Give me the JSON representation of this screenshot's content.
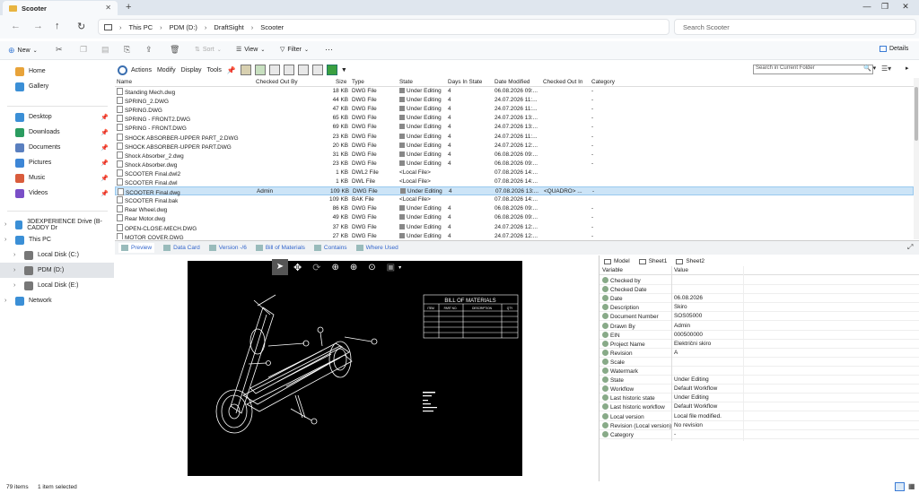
{
  "window": {
    "tab_title": "Scooter"
  },
  "address": {
    "crumbs": [
      "This PC",
      "PDM (D:)",
      "DraftSight",
      "Scooter"
    ],
    "search_placeholder": "Search Scooter"
  },
  "toolbar": {
    "new": "New",
    "sort": "Sort",
    "view": "View",
    "filter": "Filter",
    "more": "···",
    "details": "Details"
  },
  "nav": {
    "quick": [
      {
        "label": "Home",
        "color": "#e8a33a"
      },
      {
        "label": "Gallery",
        "color": "#3b8fd6"
      }
    ],
    "pinned": [
      {
        "label": "Desktop",
        "color": "#3b8fd6"
      },
      {
        "label": "Downloads",
        "color": "#2b9c60"
      },
      {
        "label": "Documents",
        "color": "#5a7fbf"
      },
      {
        "label": "Pictures",
        "color": "#3d86d6"
      },
      {
        "label": "Music",
        "color": "#d95c3c"
      },
      {
        "label": "Videos",
        "color": "#7a4fc7"
      }
    ],
    "tree": [
      {
        "label": "3DEXPERIENCE Drive (B-CADDY Dr",
        "level": 0,
        "color": "#3b8fd6"
      },
      {
        "label": "This PC",
        "level": 0,
        "color": "#3b8fd6"
      },
      {
        "label": "Local Disk (C:)",
        "level": 1,
        "color": "#777"
      },
      {
        "label": "PDM (D:)",
        "level": 1,
        "color": "#777",
        "selected": true
      },
      {
        "label": "Local Disk (E:)",
        "level": 1,
        "color": "#777"
      },
      {
        "label": "Network",
        "level": 0,
        "color": "#3b8fd6"
      }
    ]
  },
  "pdm": {
    "menus": [
      "Actions",
      "Modify",
      "Display",
      "Tools"
    ],
    "search_placeholder": "Search in Current Folder"
  },
  "files": {
    "columns": [
      "Name",
      "Checked Out By",
      "Size",
      "Type",
      "State",
      "Days In State",
      "Date Modified",
      "Checked Out In",
      "Category"
    ],
    "rows": [
      {
        "name": "Standing Mech.dwg",
        "by": "",
        "size": "18 KB",
        "type": "DWG File",
        "state": "Under Editing",
        "days": "4",
        "date": "06.08.2026 09:...",
        "in": "",
        "cat": "-"
      },
      {
        "name": "SPRING_2.DWG",
        "by": "",
        "size": "44 KB",
        "type": "DWG File",
        "state": "Under Editing",
        "days": "4",
        "date": "24.07.2026 11:...",
        "in": "",
        "cat": "-"
      },
      {
        "name": "SPRING.DWG",
        "by": "",
        "size": "47 KB",
        "type": "DWG File",
        "state": "Under Editing",
        "days": "4",
        "date": "24.07.2026 11:...",
        "in": "",
        "cat": "-"
      },
      {
        "name": "SPRING - FRONT2.DWG",
        "by": "",
        "size": "65 KB",
        "type": "DWG File",
        "state": "Under Editing",
        "days": "4",
        "date": "24.07.2026 13:...",
        "in": "",
        "cat": "-"
      },
      {
        "name": "SPRING - FRONT.DWG",
        "by": "",
        "size": "69 KB",
        "type": "DWG File",
        "state": "Under Editing",
        "days": "4",
        "date": "24.07.2026 13:...",
        "in": "",
        "cat": "-"
      },
      {
        "name": "SHOCK ABSORBER-UPPER PART_2.DWG",
        "by": "",
        "size": "23 KB",
        "type": "DWG File",
        "state": "Under Editing",
        "days": "4",
        "date": "24.07.2026 11:...",
        "in": "",
        "cat": "-"
      },
      {
        "name": "SHOCK ABSORBER-UPPER PART.DWG",
        "by": "",
        "size": "20 KB",
        "type": "DWG File",
        "state": "Under Editing",
        "days": "4",
        "date": "24.07.2026 12:...",
        "in": "",
        "cat": "-"
      },
      {
        "name": "Shock Absorber_2.dwg",
        "by": "",
        "size": "31 KB",
        "type": "DWG File",
        "state": "Under Editing",
        "days": "4",
        "date": "06.08.2026 09:...",
        "in": "",
        "cat": "-"
      },
      {
        "name": "Shock Absorber.dwg",
        "by": "",
        "size": "23 KB",
        "type": "DWG File",
        "state": "Under Editing",
        "days": "4",
        "date": "06.08.2026 09:...",
        "in": "",
        "cat": "-"
      },
      {
        "name": "SCOOTER Final.dwl2",
        "by": "",
        "size": "1 KB",
        "type": "DWL2 File",
        "state": "<Local File>",
        "days": "",
        "date": "07.08.2026 14:...",
        "in": "",
        "cat": ""
      },
      {
        "name": "SCOOTER Final.dwl",
        "by": "",
        "size": "1 KB",
        "type": "DWL File",
        "state": "<Local File>",
        "days": "",
        "date": "07.08.2026 14:...",
        "in": "",
        "cat": ""
      },
      {
        "name": "SCOOTER Final.dwg",
        "by": "Admin",
        "size": "109 KB",
        "type": "DWG File",
        "state": "Under Editing",
        "days": "4",
        "date": "07.08.2026 13:...",
        "in": "<QUADRO>  ...",
        "cat": "-",
        "selected": true
      },
      {
        "name": "SCOOTER Final.bak",
        "by": "",
        "size": "109 KB",
        "type": "BAK File",
        "state": "<Local File>",
        "days": "",
        "date": "07.08.2026 14:...",
        "in": "",
        "cat": ""
      },
      {
        "name": "Rear Wheel.dwg",
        "by": "",
        "size": "86 KB",
        "type": "DWG File",
        "state": "Under Editing",
        "days": "4",
        "date": "06.08.2026 09:...",
        "in": "",
        "cat": "-"
      },
      {
        "name": "Rear Motor.dwg",
        "by": "",
        "size": "49 KB",
        "type": "DWG File",
        "state": "Under Editing",
        "days": "4",
        "date": "06.08.2026 09:...",
        "in": "",
        "cat": "-"
      },
      {
        "name": "OPEN-CLOSE-MECH.DWG",
        "by": "",
        "size": "37 KB",
        "type": "DWG File",
        "state": "Under Editing",
        "days": "4",
        "date": "24.07.2026 12:...",
        "in": "",
        "cat": "-"
      },
      {
        "name": "MOTOR COVER.DWG",
        "by": "",
        "size": "27 KB",
        "type": "DWG File",
        "state": "Under Editing",
        "days": "4",
        "date": "24.07.2026 12:...",
        "in": "",
        "cat": "-"
      }
    ]
  },
  "lower_tabs": [
    "Preview",
    "Data Card",
    "Version -/6",
    "Bill of Materials",
    "Contains",
    "Where Used"
  ],
  "preview": {
    "bom_title": "BILL OF MATERIALS",
    "bom_headers": [
      "ITEM",
      "PART NO.",
      "DESCRIPTION",
      "QTY"
    ]
  },
  "props": {
    "tabs": [
      "Model",
      "Sheet1",
      "Sheet2"
    ],
    "columns": [
      "Variable",
      "Value"
    ],
    "rows": [
      {
        "var": "Checked by",
        "val": ""
      },
      {
        "var": "Checked Date",
        "val": ""
      },
      {
        "var": "Date",
        "val": "06.08.2026"
      },
      {
        "var": "Description",
        "val": "Skiro"
      },
      {
        "var": "Document Number",
        "val": "SOS05000"
      },
      {
        "var": "Drawn By",
        "val": "Admin"
      },
      {
        "var": "EIN",
        "val": "000500000"
      },
      {
        "var": "Project Name",
        "val": "Električni skiro"
      },
      {
        "var": "Revision",
        "val": "A"
      },
      {
        "var": "Scale",
        "val": ""
      },
      {
        "var": "Watermark",
        "val": ""
      },
      {
        "var": "State",
        "val": "Under Editing"
      },
      {
        "var": "Workflow",
        "val": "Default Workflow"
      },
      {
        "var": "Last historic state",
        "val": "Under Editing"
      },
      {
        "var": "Last historic workflow",
        "val": "Default Workflow"
      },
      {
        "var": "Local version",
        "val": "Local file modified."
      },
      {
        "var": "Revision (Local version)",
        "val": "No revision"
      },
      {
        "var": "Category",
        "val": "-"
      }
    ]
  },
  "status": {
    "items": "79 items",
    "selected": "1 item selected"
  }
}
